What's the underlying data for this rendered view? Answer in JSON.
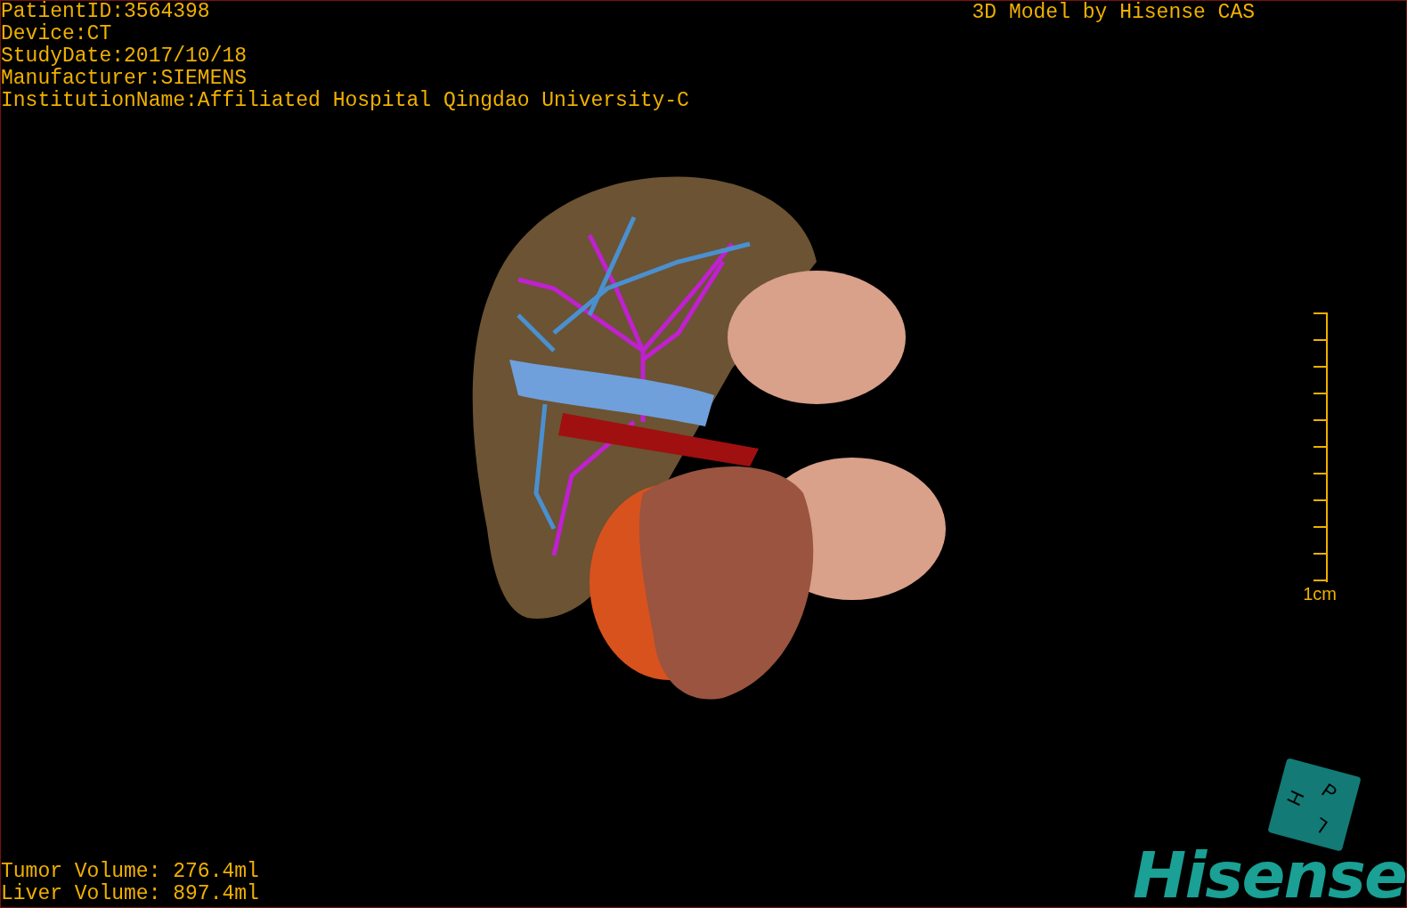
{
  "study_info": [
    "PatientID:3564398",
    "Device:CT",
    "StudyDate:2017/10/18",
    "Manufacturer:SIEMENS",
    "InstitutionName:Affiliated Hospital Qingdao University-C"
  ],
  "title": "3D Model by Hisense CAS",
  "scale": {
    "label": "1cm"
  },
  "volumes": [
    "Tumor Volume: 276.4ml",
    "Liver Volume: 897.4ml"
  ],
  "orientation_cube": {
    "faces": [
      "P",
      "H",
      "L"
    ]
  },
  "logo": "Hisense"
}
